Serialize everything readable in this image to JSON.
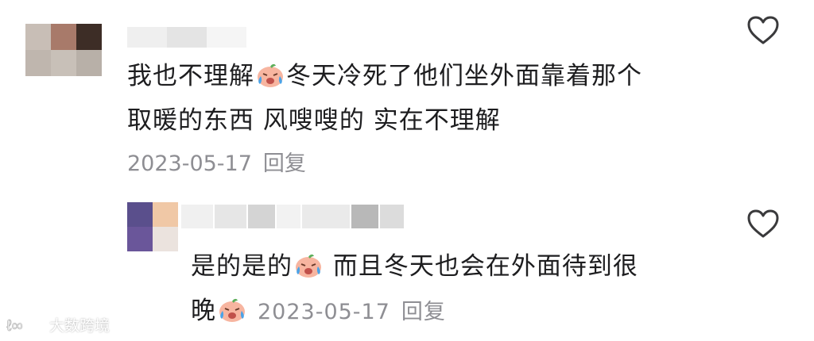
{
  "comments": [
    {
      "line1_a": "我也不理解",
      "line1_b": "冬天冷死了他们坐外面靠着那个",
      "line2": "取暖的东西 风嗖嗖的 实在不理解",
      "date": "2023-05-17",
      "reply_label": "回复",
      "avatar_colors": [
        "#c8beb6",
        "#a87a6a",
        "#3d2d26",
        "#bfb6ae",
        "#c8c0b8",
        "#b8b0a8"
      ],
      "name_blocks": [
        "#efefef",
        "#e7e7e7",
        "#f3f3f3"
      ]
    },
    {
      "line1_a": "是的是的",
      "line1_b": " 而且冬天也会在外面待到很",
      "line2": "晚",
      "date": "2023-05-17",
      "reply_label": "回复",
      "avatar_colors": [
        "#5a4f8c",
        "#f0c8a6",
        "#6a569a",
        "#e8e0dc"
      ],
      "name_blocks": [
        "#f0f0f0",
        "#e9e9e9",
        "#d8d8d8",
        "#f2f2f2",
        "#ececec",
        "#b8b8b8",
        "#dddddd"
      ]
    }
  ],
  "watermark": "大数跨境",
  "icons": [
    "heart-icon",
    "crying-emoji-icon"
  ]
}
